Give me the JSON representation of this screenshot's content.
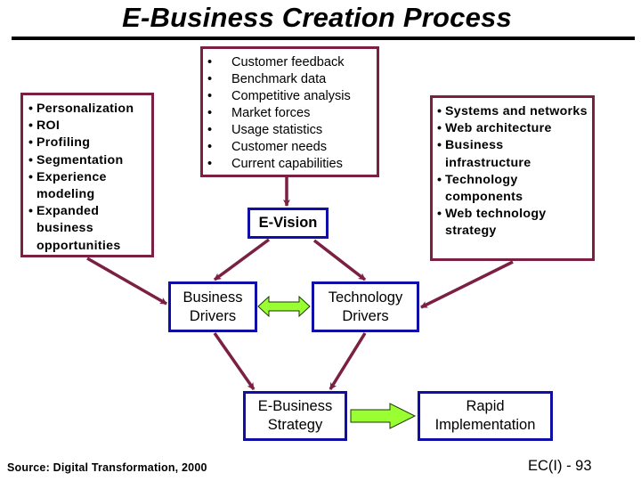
{
  "title": "E-Business Creation Process",
  "colors": {
    "maroon": "#7b2043",
    "blue": "#0f0fa8",
    "green": "#99ff33"
  },
  "left_box": {
    "items": [
      {
        "bullet": "•",
        "text": "Personalization"
      },
      {
        "bullet": "•",
        "text": "ROI"
      },
      {
        "bullet": "•",
        "text": "Profiling"
      },
      {
        "bullet": "•",
        "text": "Segmentation"
      },
      {
        "bullet": "•",
        "text": "Experience modeling"
      },
      {
        "bullet": "•",
        "text": "Expanded business opportunities"
      }
    ]
  },
  "center_box": {
    "items": [
      {
        "bullet": "•",
        "text": "Customer feedback"
      },
      {
        "bullet": "•",
        "text": "Benchmark data"
      },
      {
        "bullet": "•",
        "text": "Competitive analysis"
      },
      {
        "bullet": "•",
        "text": "Market forces"
      },
      {
        "bullet": "•",
        "text": "Usage statistics"
      },
      {
        "bullet": "•",
        "text": "Customer needs"
      },
      {
        "bullet": "•",
        "text": "Current capabilities"
      }
    ]
  },
  "right_box": {
    "items": [
      {
        "bullet": "•",
        "text": "Systems and networks"
      },
      {
        "bullet": "•",
        "text": "Web architecture"
      },
      {
        "bullet": "•",
        "text": "Business infrastructure"
      },
      {
        "bullet": "•",
        "text": "Technology components"
      },
      {
        "bullet": "•",
        "text": "Web technology strategy"
      }
    ]
  },
  "nodes": {
    "evision": "E-Vision",
    "business_drivers": {
      "line1": "Business",
      "line2": "Drivers"
    },
    "technology_drivers": {
      "line1": "Technology",
      "line2": "Drivers"
    },
    "ebusiness_strategy": {
      "line1": "E-Business",
      "line2": "Strategy"
    },
    "rapid_implementation": {
      "line1": "Rapid",
      "line2": "Implementation"
    }
  },
  "edges": [
    {
      "from": "center_box",
      "to": "evision",
      "style": "arrow"
    },
    {
      "from": "evision",
      "to": "business_drivers",
      "style": "arrow"
    },
    {
      "from": "evision",
      "to": "technology_drivers",
      "style": "arrow"
    },
    {
      "from": "left_box",
      "to": "business_drivers",
      "style": "arrow"
    },
    {
      "from": "right_box",
      "to": "technology_drivers",
      "style": "arrow"
    },
    {
      "from": "business_drivers",
      "to": "technology_drivers",
      "style": "double-block-arrow"
    },
    {
      "from": "business_drivers",
      "to": "ebusiness_strategy",
      "style": "arrow"
    },
    {
      "from": "technology_drivers",
      "to": "ebusiness_strategy",
      "style": "arrow"
    },
    {
      "from": "ebusiness_strategy",
      "to": "rapid_implementation",
      "style": "block-arrow"
    }
  ],
  "footer": {
    "source": "Source: Digital Transformation, 2000",
    "page": "EC(I) - 93"
  }
}
